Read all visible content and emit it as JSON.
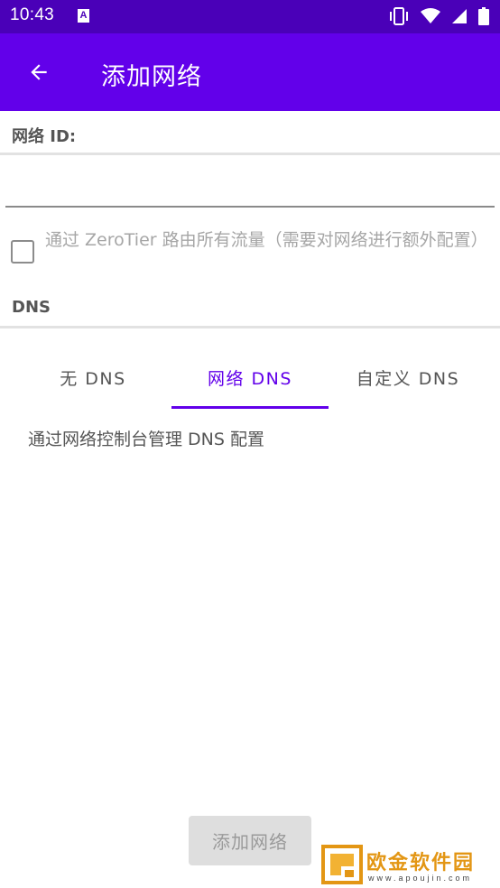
{
  "status_bar": {
    "time": "10:43",
    "notification_letter": "A",
    "icons": [
      "vibrate-icon",
      "wifi-icon",
      "signal-icon",
      "battery-icon"
    ]
  },
  "app_bar": {
    "title": "添加网络",
    "back_icon": "arrow-back-icon"
  },
  "form": {
    "network_id_label": "网络 ID:",
    "network_id_value": "",
    "route_all_traffic_label": "通过 ZeroTier 路由所有流量（需要对网络进行额外配置）",
    "route_all_traffic_checked": false,
    "dns_label": "DNS"
  },
  "dns_tabs": {
    "items": [
      {
        "label": "无 DNS",
        "active": false
      },
      {
        "label": "网络 DNS",
        "active": true
      },
      {
        "label": "自定义 DNS",
        "active": false
      }
    ],
    "active_description": "通过网络控制台管理 DNS 配置"
  },
  "submit_button": {
    "label": "添加网络",
    "enabled": false
  },
  "watermark": {
    "title": "欧金软件园",
    "url": "www.apoujin.com"
  },
  "colors": {
    "primary": "#6200ea",
    "status_bar": "#4a00b8",
    "watermark_orange": "#e39614"
  }
}
